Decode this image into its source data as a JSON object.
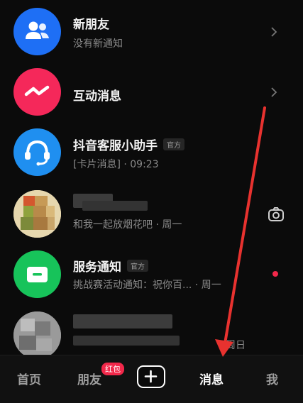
{
  "messages": [
    {
      "title": "新朋友",
      "subtitle": "没有新通知",
      "icon": "people-icon",
      "avatar_color": "#1e6ff5"
    },
    {
      "title": "互动消息",
      "subtitle": "",
      "icon": "lightning-icon",
      "avatar_color": "#f5285a"
    },
    {
      "title": "抖音客服小助手",
      "tag": "官方",
      "subtitle": "[卡片消息] · 09:23",
      "icon": "headset-icon",
      "avatar_color": "#1f8ff0"
    },
    {
      "title": "",
      "subtitle": "和我一起放烟花吧 · 周一",
      "icon": "camera-icon"
    },
    {
      "title": "服务通知",
      "tag": "官方",
      "subtitle": "挑战赛活动通知：祝你百... · 周一",
      "icon": "inbox-icon",
      "avatar_color": "#17c35a"
    },
    {
      "title": "",
      "subtitle": "",
      "time": "周日"
    }
  ],
  "nav": {
    "home": "首页",
    "friends": "朋友",
    "friends_badge": "红包",
    "messages": "消息",
    "me": "我"
  },
  "colors": {
    "accent_red": "#e8322f",
    "badge_red": "#f2284a",
    "unread_dot": "#f2284a"
  }
}
